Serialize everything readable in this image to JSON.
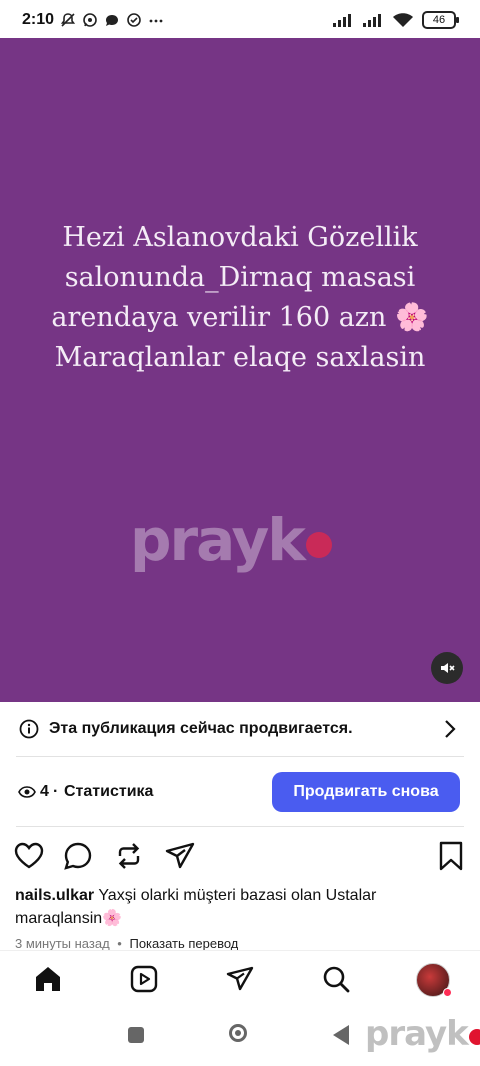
{
  "status_bar": {
    "time": "2:10",
    "battery": "46",
    "icons_left": [
      "mute-bell-icon",
      "whatsapp-icon",
      "chat-bubble-icon",
      "whatsapp-icon",
      "more-dots-icon"
    ],
    "icons_right": [
      "signal-icon",
      "signal-icon",
      "wifi-icon",
      "battery-icon"
    ]
  },
  "post": {
    "media_text": "Hezi Aslanovdaki Gözellik salonunda_Dirnaq masasi arendaya verilir 160 azn 🌸 Maraqlanlar elaqe saxlasin",
    "watermark": "prayk",
    "media_bg": "#763585",
    "promo_banner": "Эта публикация сейчас продвигается.",
    "stats_count": "4",
    "stats_separator": "·",
    "stats_label": "Статистика",
    "promote_button": "Продвигать снова",
    "promote_color": "#4a5cf0",
    "username": "nails.ulkar",
    "caption": "Yaxşi olarki müşteri bazasi olan Ustalar maraqlansin🌸",
    "time_ago": "3 минуты назад",
    "meta_separator": "•",
    "translate": "Показать перевод"
  },
  "bottom_nav": [
    "home-icon",
    "reels-icon",
    "send-icon",
    "search-icon",
    "profile-avatar"
  ],
  "system_nav_watermark": "prayk"
}
